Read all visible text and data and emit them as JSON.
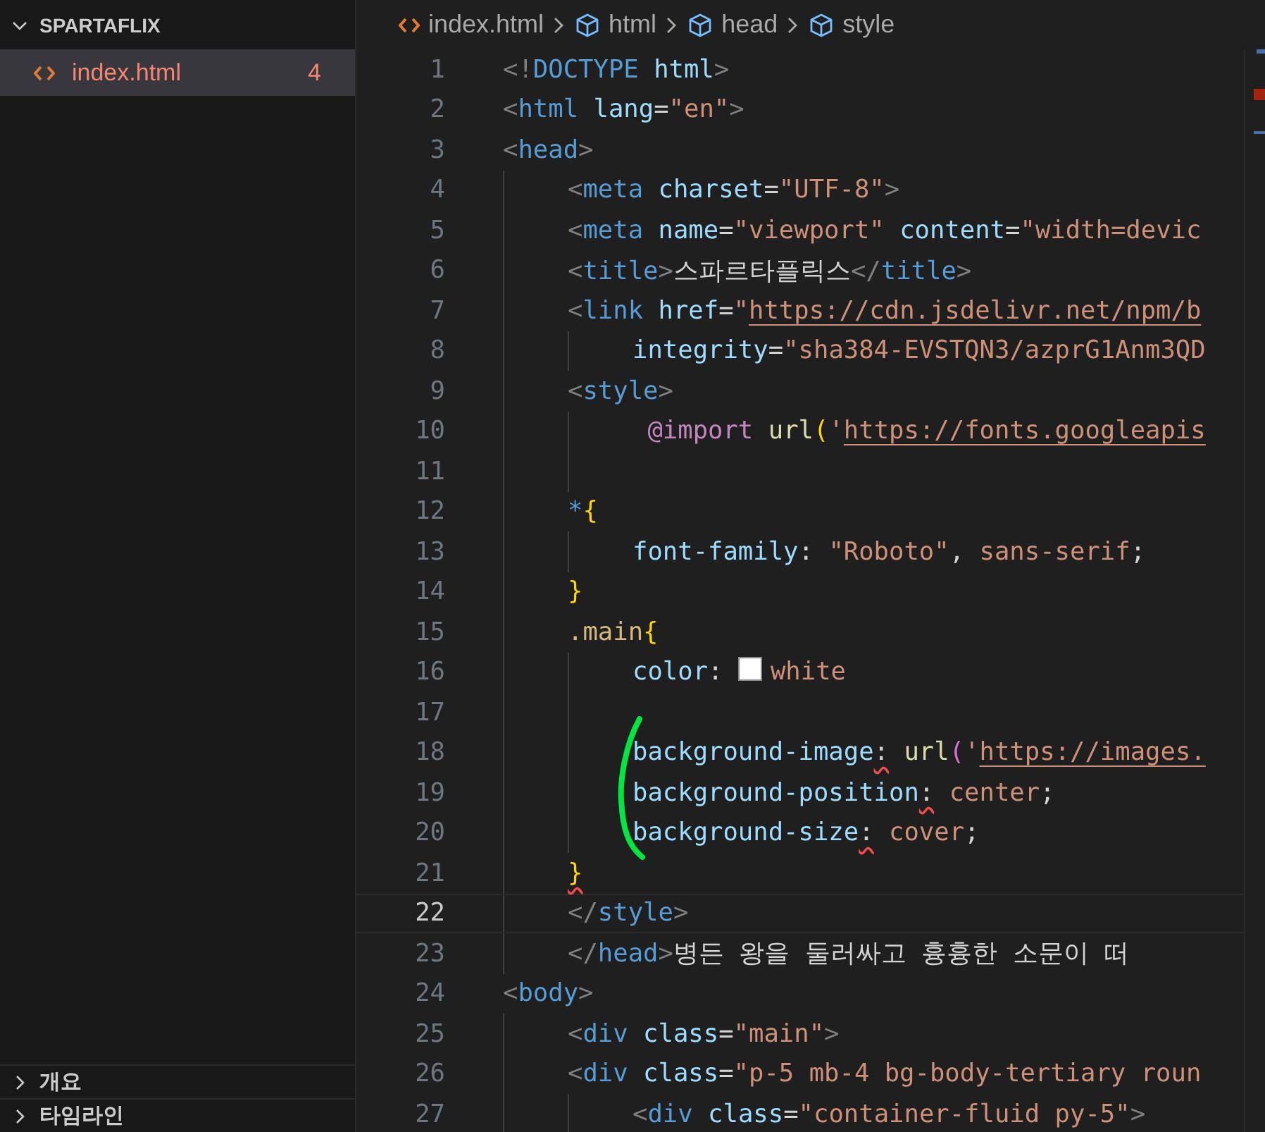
{
  "explorer": {
    "folder": {
      "name": "SPARTAFLIX",
      "expanded": true
    },
    "files": [
      {
        "name": "index.html",
        "problems": "4",
        "has_errors": true,
        "selected": true
      }
    ],
    "sections": [
      {
        "title": "개요",
        "expanded": false
      },
      {
        "title": "타임라인",
        "expanded": false
      }
    ]
  },
  "breadcrumb": [
    {
      "label": "index.html",
      "kind": "file"
    },
    {
      "label": "html",
      "kind": "element"
    },
    {
      "label": "head",
      "kind": "element"
    },
    {
      "label": "style",
      "kind": "element"
    }
  ],
  "editor": {
    "lines": [
      {
        "number": "1",
        "current": false,
        "tokens": [
          {
            "kind": "punct",
            "text": "<!"
          },
          {
            "kind": "tag",
            "text": "DOCTYPE"
          },
          {
            "kind": "attr",
            "text": " html"
          },
          {
            "kind": "punct",
            "text": ">"
          }
        ]
      },
      {
        "number": "2",
        "current": false,
        "tokens": [
          {
            "kind": "punct",
            "text": "<"
          },
          {
            "kind": "tag",
            "text": "html"
          },
          {
            "kind": "attr",
            "text": " lang"
          },
          {
            "kind": "plain",
            "text": "="
          },
          {
            "kind": "str",
            "text": "\"en\""
          },
          {
            "kind": "punct",
            "text": ">"
          }
        ]
      },
      {
        "number": "3",
        "current": false,
        "tokens": [
          {
            "kind": "punct",
            "text": "<"
          },
          {
            "kind": "tag",
            "text": "head"
          },
          {
            "kind": "punct",
            "text": ">"
          }
        ],
        "children": [
          {
            "number": "4",
            "current": false,
            "tokens": [
              {
                "kind": "punct",
                "text": "<"
              },
              {
                "kind": "tag",
                "text": "meta"
              },
              {
                "kind": "attr",
                "text": " charset"
              },
              {
                "kind": "plain",
                "text": "="
              },
              {
                "kind": "str",
                "text": "\"UTF-8\""
              },
              {
                "kind": "punct",
                "text": ">"
              }
            ]
          },
          {
            "number": "5",
            "current": false,
            "tokens": [
              {
                "kind": "punct",
                "text": "<"
              },
              {
                "kind": "tag",
                "text": "meta"
              },
              {
                "kind": "attr",
                "text": " name"
              },
              {
                "kind": "plain",
                "text": "="
              },
              {
                "kind": "str",
                "text": "\"viewport\""
              },
              {
                "kind": "attr",
                "text": " content"
              },
              {
                "kind": "plain",
                "text": "="
              },
              {
                "kind": "str",
                "text": "\"width=devic"
              }
            ]
          },
          {
            "number": "6",
            "current": false,
            "tokens": [
              {
                "kind": "punct",
                "text": "<"
              },
              {
                "kind": "tag",
                "text": "title"
              },
              {
                "kind": "punct",
                "text": ">"
              },
              {
                "kind": "plain",
                "text": "스파르타플릭스"
              },
              {
                "kind": "punct",
                "text": "</"
              },
              {
                "kind": "tag",
                "text": "title"
              },
              {
                "kind": "punct",
                "text": ">"
              }
            ]
          },
          {
            "number": "7",
            "current": false,
            "tokens": [
              {
                "kind": "punct",
                "text": "<"
              },
              {
                "kind": "tag",
                "text": "link"
              },
              {
                "kind": "attr",
                "text": " href"
              },
              {
                "kind": "plain",
                "text": "="
              },
              {
                "kind": "str",
                "text": "\""
              },
              {
                "kind": "link",
                "text": "https://cdn.jsdelivr.net/npm/b"
              }
            ],
            "children": [
              {
                "number": "8",
                "current": false,
                "tokens": [
                  {
                    "kind": "attr",
                    "text": "integrity"
                  },
                  {
                    "kind": "plain",
                    "text": "="
                  },
                  {
                    "kind": "str",
                    "text": "\"sha384-EVSTQN3/azprG1Anm3QD"
                  }
                ]
              }
            ]
          },
          {
            "number": "9",
            "current": false,
            "tokens": [
              {
                "kind": "punct",
                "text": "<"
              },
              {
                "kind": "tag",
                "text": "style"
              },
              {
                "kind": "punct",
                "text": ">"
              }
            ],
            "children": [
              {
                "number": "10",
                "current": false,
                "tokens": [
                  {
                    "kind": "at",
                    "text": " @import"
                  },
                  {
                    "kind": "fn",
                    "text": " url"
                  },
                  {
                    "kind": "brace",
                    "text": "("
                  },
                  {
                    "kind": "str",
                    "text": "'"
                  },
                  {
                    "kind": "link",
                    "text": "https://fonts.googleapis"
                  }
                ]
              },
              {
                "number": "11",
                "current": false
              }
            ]
          },
          {
            "number": "12",
            "current": false,
            "tokens": [
              {
                "kind": "tag",
                "text": "*"
              },
              {
                "kind": "brace",
                "text": "{"
              }
            ],
            "children": [
              {
                "number": "13",
                "current": false,
                "tokens": [
                  {
                    "kind": "attr",
                    "text": "font-family"
                  },
                  {
                    "kind": "plain",
                    "text": ": "
                  },
                  {
                    "kind": "str",
                    "text": "\"Roboto\""
                  },
                  {
                    "kind": "plain",
                    "text": ", "
                  },
                  {
                    "kind": "str",
                    "text": "sans-serif"
                  },
                  {
                    "kind": "plain",
                    "text": ";"
                  }
                ]
              }
            ]
          },
          {
            "number": "14",
            "current": false,
            "tokens": [
              {
                "kind": "brace",
                "text": "}"
              }
            ]
          },
          {
            "number": "15",
            "current": false,
            "tokens": [
              {
                "kind": "sel",
                "text": ".main"
              },
              {
                "kind": "brace",
                "text": "{"
              }
            ],
            "children": [
              {
                "number": "16",
                "current": false,
                "tokens": [
                  {
                    "kind": "attr",
                    "text": "color"
                  },
                  {
                    "kind": "plain",
                    "text": ": "
                  },
                  {
                    "kind": "swatch",
                    "color": "#ffffff"
                  },
                  {
                    "kind": "str",
                    "text": "white"
                  }
                ]
              },
              {
                "number": "17",
                "current": false
              },
              {
                "number": "18",
                "current": false,
                "tokens": [
                  {
                    "kind": "attr",
                    "text": "background-image"
                  },
                  {
                    "kind": "errplain",
                    "text": ":"
                  },
                  {
                    "kind": "fn",
                    "text": " url"
                  },
                  {
                    "kind": "paren",
                    "text": "("
                  },
                  {
                    "kind": "str",
                    "text": "'"
                  },
                  {
                    "kind": "link",
                    "text": "https://images."
                  }
                ]
              },
              {
                "number": "19",
                "current": false,
                "tokens": [
                  {
                    "kind": "attr",
                    "text": "background-position"
                  },
                  {
                    "kind": "errplain",
                    "text": ":"
                  },
                  {
                    "kind": "str",
                    "text": " center"
                  },
                  {
                    "kind": "plain",
                    "text": ";"
                  }
                ]
              },
              {
                "number": "20",
                "current": false,
                "tokens": [
                  {
                    "kind": "attr",
                    "text": "background-size"
                  },
                  {
                    "kind": "errplain",
                    "text": ":"
                  },
                  {
                    "kind": "str",
                    "text": " cover"
                  },
                  {
                    "kind": "plain",
                    "text": ";"
                  }
                ]
              }
            ]
          },
          {
            "number": "21",
            "current": false,
            "tokens": [
              {
                "kind": "errbrace",
                "text": "}"
              }
            ]
          },
          {
            "number": "22",
            "current": true,
            "tokens": [
              {
                "kind": "punct",
                "text": "</"
              },
              {
                "kind": "tag",
                "text": "style"
              },
              {
                "kind": "punct",
                "text": ">"
              }
            ]
          },
          {
            "number": "23",
            "current": false,
            "tokens": [
              {
                "kind": "punct",
                "text": "</"
              },
              {
                "kind": "tag",
                "text": "head"
              },
              {
                "kind": "punct",
                "text": ">"
              },
              {
                "kind": "plain",
                "text": "병든 왕을 둘러싸고 흉흉한 소문이 떠"
              }
            ]
          }
        ]
      },
      {
        "number": "24",
        "current": false,
        "tokens": [
          {
            "kind": "punct",
            "text": "<"
          },
          {
            "kind": "tag",
            "text": "body"
          },
          {
            "kind": "punct",
            "text": ">"
          }
        ],
        "children": [
          {
            "number": "25",
            "current": false,
            "tokens": [
              {
                "kind": "punct",
                "text": "<"
              },
              {
                "kind": "tag",
                "text": "div"
              },
              {
                "kind": "attr",
                "text": " class"
              },
              {
                "kind": "plain",
                "text": "="
              },
              {
                "kind": "str",
                "text": "\"main\""
              },
              {
                "kind": "punct",
                "text": ">"
              }
            ]
          },
          {
            "number": "26",
            "current": false,
            "tokens": [
              {
                "kind": "punct",
                "text": "<"
              },
              {
                "kind": "tag",
                "text": "div"
              },
              {
                "kind": "attr",
                "text": " class"
              },
              {
                "kind": "plain",
                "text": "="
              },
              {
                "kind": "str",
                "text": "\"p-5 mb-4 bg-body-tertiary roun"
              }
            ],
            "children": [
              {
                "number": "27",
                "current": false,
                "tokens": [
                  {
                    "kind": "punct",
                    "text": "<"
                  },
                  {
                    "kind": "tag",
                    "text": "div"
                  },
                  {
                    "kind": "attr",
                    "text": " class"
                  },
                  {
                    "kind": "plain",
                    "text": "="
                  },
                  {
                    "kind": "str",
                    "text": "\"container-fluid py-5\""
                  },
                  {
                    "kind": "punct",
                    "text": ">"
                  }
                ]
              }
            ]
          }
        ]
      }
    ]
  }
}
